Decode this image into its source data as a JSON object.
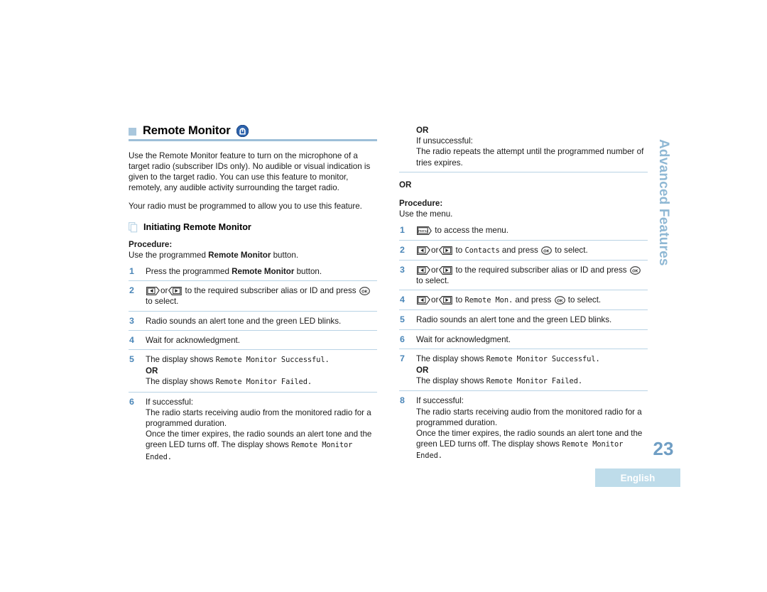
{
  "document": {
    "heading": "Remote Monitor",
    "heading_icon": "microphone-icon",
    "intro_paragraph_1": "Use the Remote Monitor feature to turn on the microphone of a target radio (subscriber IDs only). No audible or visual indication is given to the target radio. You can use this feature to monitor, remotely, any audible activity surrounding the target radio.",
    "intro_paragraph_2": "Your radio must be programmed to allow you to use this feature.",
    "subheading": "Initiating Remote Monitor",
    "subheading_icon": "documents-icon"
  },
  "colors": {
    "accent_blue": "#4a86b8",
    "rule_blue": "#b9d3e5",
    "bullet_blue": "#a9c7dd",
    "tab_blue": "#8fb8d4",
    "lang_box_blue": "#bedcea",
    "page_number_blue": "#6f9ec4"
  },
  "left_column": {
    "procedure_label": "Procedure:",
    "procedure_lead_pre": "Use the programmed ",
    "procedure_lead_bold": "Remote Monitor",
    "procedure_lead_post": " button.",
    "steps": [
      {
        "num": "1",
        "pre": "Press the programmed ",
        "bold": "Remote Monitor",
        "post": " button."
      },
      {
        "num": "2",
        "icon_left": "arrow-left-key-icon",
        "or_text": "or",
        "icon_right": "arrow-right-key-icon",
        "mid": " to the required subscriber alias or ID and press ",
        "icon_ok": "ok-key-icon",
        "tail": " to select."
      },
      {
        "num": "3",
        "text": "Radio sounds an alert tone and the green LED blinks."
      },
      {
        "num": "4",
        "text": "Wait for acknowledgment."
      },
      {
        "num": "5",
        "line1_pre": "The display shows ",
        "line1_mono": "Remote Monitor Successful.",
        "or_label": "OR",
        "line2_pre": "The display shows ",
        "line2_mono": "Remote Monitor Failed."
      },
      {
        "num": "6",
        "line1": "If successful:",
        "line2": "The radio starts receiving audio from the monitored radio for a programmed duration.",
        "line3_pre": "Once the timer expires, the radio sounds an alert tone and the green LED turns off. The display shows ",
        "line3_mono": "Remote Monitor Ended."
      }
    ]
  },
  "right_column": {
    "top_block": {
      "or_label": "OR",
      "line1": "If unsuccessful:",
      "line2": "The radio repeats the attempt until the programmed number of tries expires."
    },
    "or_divider": "OR",
    "procedure_label": "Procedure:",
    "procedure_lead": "Use the menu.",
    "steps": [
      {
        "num": "1",
        "icon_menu": "menu-key-icon",
        "tail": " to access the menu."
      },
      {
        "num": "2",
        "icon_left": "arrow-left-key-icon",
        "or_text": "or",
        "icon_right": "arrow-right-key-icon",
        "mid_pre": " to ",
        "mid_mono": "Contacts",
        "mid_post": " and press ",
        "icon_ok": "ok-key-icon",
        "tail": " to select."
      },
      {
        "num": "3",
        "icon_left": "arrow-left-key-icon",
        "or_text": "or",
        "icon_right": "arrow-right-key-icon",
        "mid": " to the required subscriber alias or ID and press ",
        "icon_ok": "ok-key-icon",
        "tail": " to select."
      },
      {
        "num": "4",
        "icon_left": "arrow-left-key-icon",
        "or_text": "or",
        "icon_right": "arrow-right-key-icon",
        "mid_pre": " to ",
        "mid_mono": "Remote Mon.",
        "mid_post": " and press ",
        "icon_ok": "ok-key-icon",
        "tail": " to select."
      },
      {
        "num": "5",
        "text": "Radio sounds an alert tone and the green LED blinks."
      },
      {
        "num": "6",
        "text": "Wait for acknowledgment."
      },
      {
        "num": "7",
        "line1_pre": "The display shows ",
        "line1_mono": "Remote Monitor Successful.",
        "or_label": "OR",
        "line2_pre": "The display shows ",
        "line2_mono": "Remote Monitor Failed."
      },
      {
        "num": "8",
        "line1": "If successful:",
        "line2": "The radio starts receiving audio from the monitored radio for a programmed duration.",
        "line3_pre": "Once the timer expires, the radio sounds an alert tone and the green LED turns off. The display shows ",
        "line3_mono": "Remote Monitor Ended."
      }
    ]
  },
  "margin": {
    "section_tab": "Advanced Features",
    "page_number": "23",
    "language": "English"
  }
}
